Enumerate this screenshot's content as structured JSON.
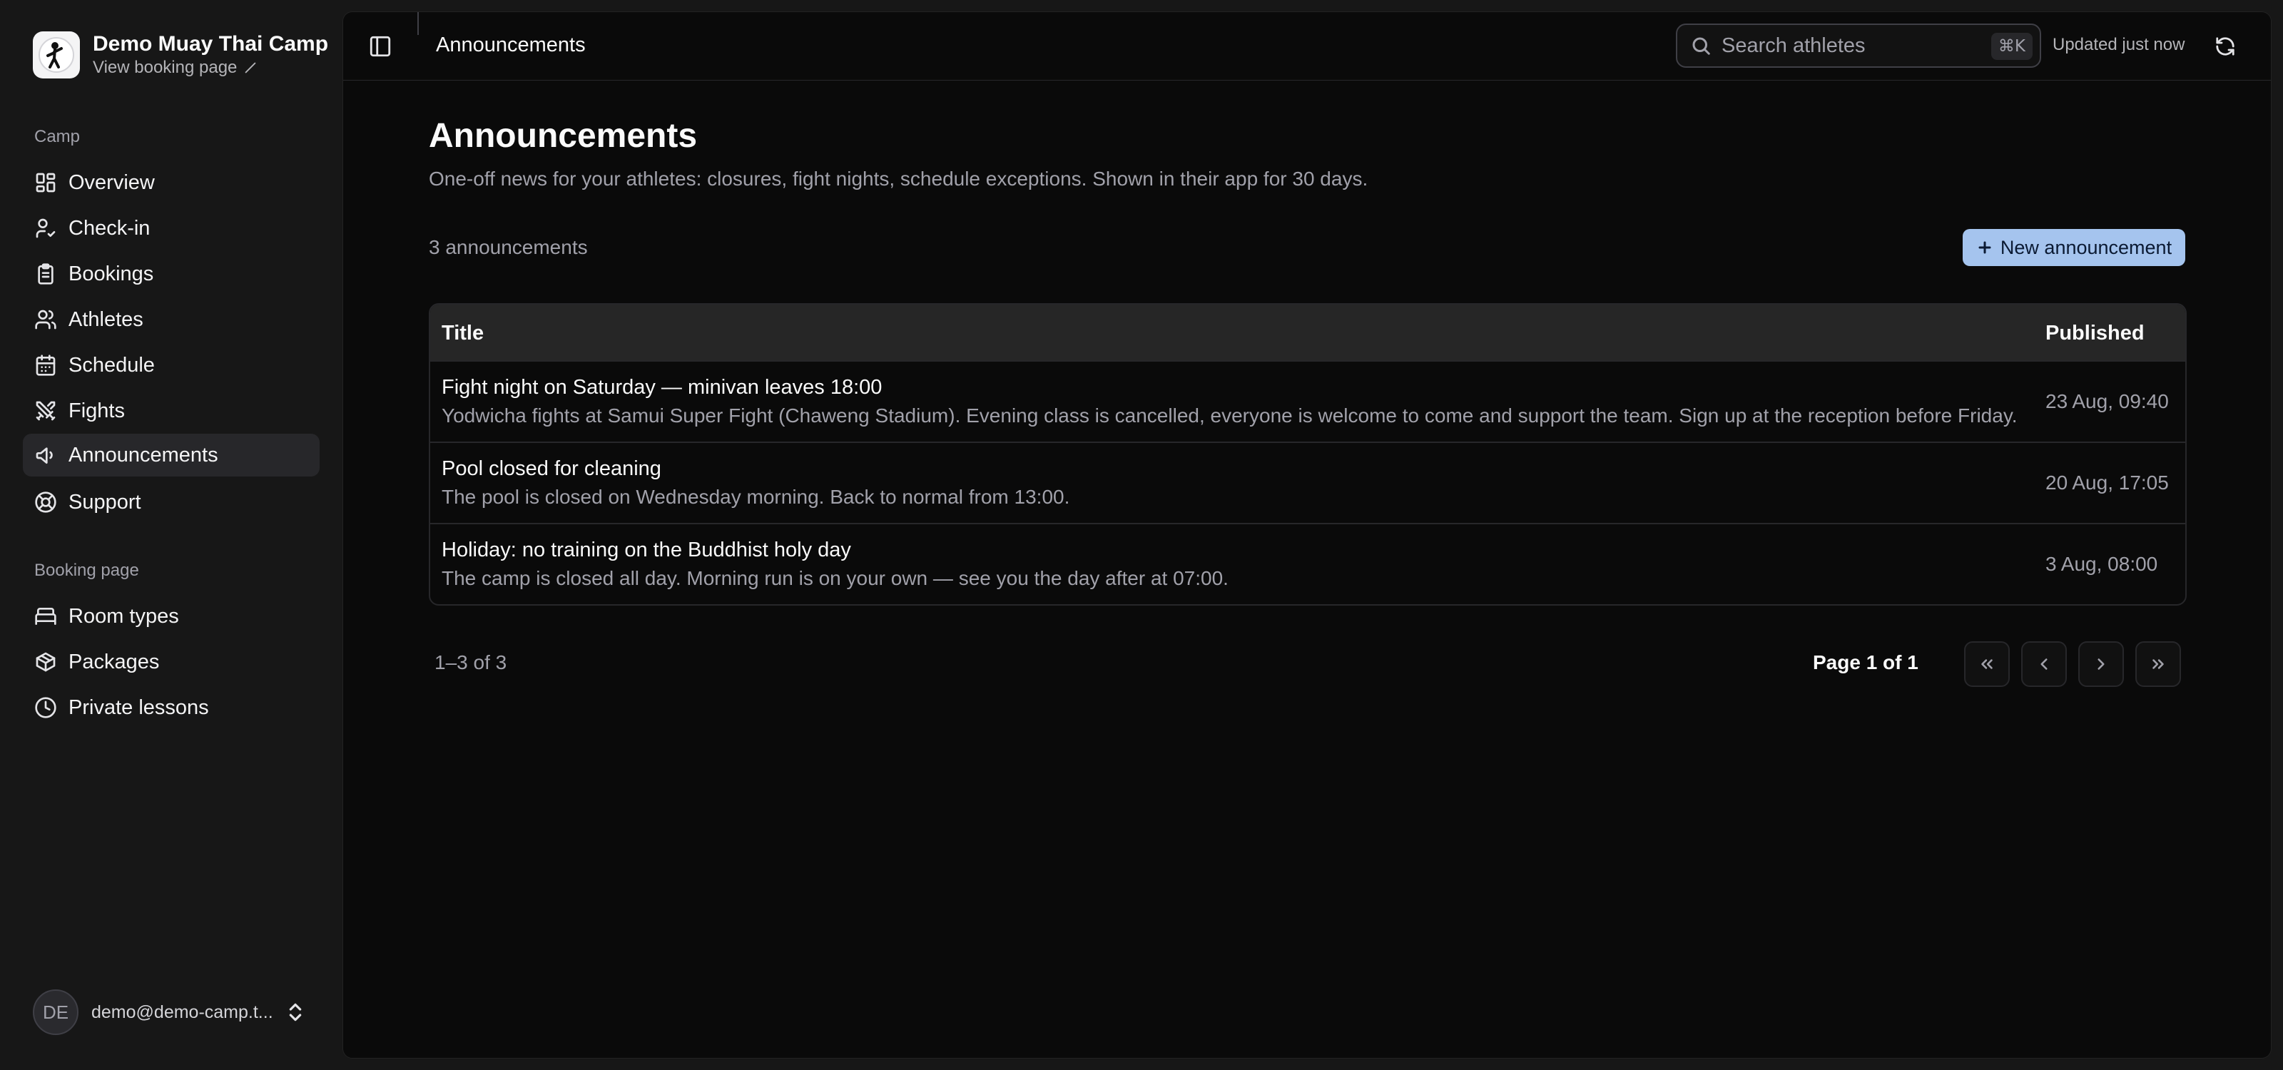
{
  "brand": {
    "name": "Demo Muay Thai Camp",
    "link_label": "View booking page",
    "logo_icon": "fighter-logo-icon"
  },
  "sidebar": {
    "groups": [
      {
        "label": "Camp",
        "items": [
          {
            "label": "Overview",
            "icon": "grid-icon"
          },
          {
            "label": "Check-in",
            "icon": "user-check-icon"
          },
          {
            "label": "Bookings",
            "icon": "clipboard-icon"
          },
          {
            "label": "Athletes",
            "icon": "users-icon"
          },
          {
            "label": "Schedule",
            "icon": "calendar-icon"
          },
          {
            "label": "Fights",
            "icon": "swords-icon"
          },
          {
            "label": "Announcements",
            "icon": "megaphone-icon",
            "active": true
          },
          {
            "label": "Support",
            "icon": "life-buoy-icon"
          }
        ]
      },
      {
        "label": "Booking page",
        "items": [
          {
            "label": "Room types",
            "icon": "bed-icon"
          },
          {
            "label": "Packages",
            "icon": "package-icon"
          },
          {
            "label": "Private lessons",
            "icon": "clock-icon"
          }
        ]
      }
    ]
  },
  "user": {
    "initials": "DE",
    "email": "demo@demo-camp.t..."
  },
  "topbar": {
    "title": "Announcements",
    "search_placeholder": "Search athletes",
    "shortcut": "⌘K",
    "updated": "Updated just now"
  },
  "page": {
    "title": "Announcements",
    "description": "One-off news for your athletes: closures, fight nights, schedule exceptions. Shown in their app for 30 days.",
    "count": "3 announcements",
    "new_button": "New announcement"
  },
  "table": {
    "columns": [
      "Title",
      "Published"
    ],
    "rows": [
      {
        "title": "Fight night on Saturday — minivan leaves 18:00",
        "body": "Yodwicha fights at Samui Super Fight (Chaweng Stadium). Evening class is cancelled, everyone is welcome to come and support the team. Sign up at the reception before Friday.",
        "published": "23 Aug, 09:40"
      },
      {
        "title": "Pool closed for cleaning",
        "body": "The pool is closed on Wednesday morning. Back to normal from 13:00.",
        "published": "20 Aug, 17:05"
      },
      {
        "title": "Holiday: no training on the Buddhist holy day",
        "body": "The camp is closed all day. Morning run is on your own — see you the day after at 07:00.",
        "published": "3 Aug, 08:00"
      }
    ]
  },
  "pagination": {
    "range": "1–3 of 3",
    "page_label": "Page 1 of 1"
  },
  "colors": {
    "accent": "#a5c4ee",
    "background": "#0a0a0a",
    "sidebar": "#171717"
  }
}
